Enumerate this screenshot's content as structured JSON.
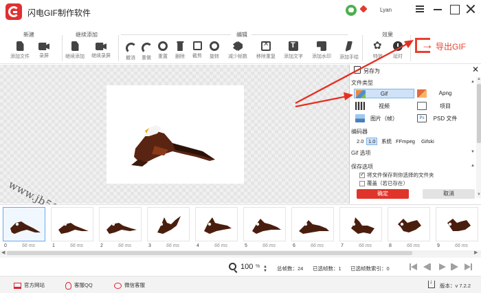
{
  "app": {
    "title": "闪电GIF制作软件",
    "user": "Lyan"
  },
  "toolbar": {
    "groups": {
      "new": "新建",
      "continue_add": "继续添加",
      "edit": "编辑",
      "effects": "效果"
    },
    "buttons": {
      "add_file": "添加文件",
      "record": "录屏",
      "cont_add": "继续添加",
      "cont_record": "继续录屏",
      "undo": "撤消",
      "redo": "重做",
      "reset": "重置",
      "delete": "删除",
      "crop": "截剪",
      "rotate": "旋转",
      "reduce_frames": "减少帧数",
      "remove_dup": "移除重复",
      "add_text": "添加文字",
      "add_watermark": "添加水印",
      "add_handwrite": "添加手绘",
      "effect": "特效",
      "frame_delay": "延时"
    },
    "export_label": "导出GIF",
    "accent": "#e8402e"
  },
  "canvas": {
    "watermark": "www.jb51.net"
  },
  "save_panel": {
    "title": "另存为",
    "file_type_label": "文件类型",
    "file_types": [
      {
        "label": "Gif",
        "selected": true
      },
      {
        "label": "Apng",
        "selected": false
      },
      {
        "label": "视频",
        "selected": false
      },
      {
        "label": "项目",
        "selected": false
      },
      {
        "label": "图片（帧）",
        "selected": false
      },
      {
        "label": "PSD 文件",
        "selected": false
      }
    ],
    "encoder_label": "编码器",
    "encoders": [
      "2.0",
      "1.0",
      "系统",
      "FFmpeg",
      "Gifski"
    ],
    "encoder_selected": "1.0",
    "gif_options_label": "Gif 选项",
    "save_options_label": "保存选项",
    "save_to_folder": "将文件保存到你选择的文件夹",
    "overwrite": "覆盖（若已存在）",
    "ok": "确定",
    "cancel": "取消"
  },
  "frames": [
    {
      "index": "0",
      "ms": "66 ms"
    },
    {
      "index": "1",
      "ms": "66 ms"
    },
    {
      "index": "2",
      "ms": "66 ms"
    },
    {
      "index": "3",
      "ms": "66 ms"
    },
    {
      "index": "4",
      "ms": "66 ms"
    },
    {
      "index": "5",
      "ms": "66 ms"
    },
    {
      "index": "6",
      "ms": "66 ms"
    },
    {
      "index": "7",
      "ms": "66 ms"
    },
    {
      "index": "8",
      "ms": "66 ms"
    },
    {
      "index": "9",
      "ms": "66 ms"
    }
  ],
  "status": {
    "zoom": "100",
    "zoom_unit": "%",
    "total_frames": "总帧数：24",
    "selected_frames": "已选帧数：1",
    "selected_index": "已选帧数索引：0"
  },
  "footer": {
    "website": "官方网站",
    "qq": "客服QQ",
    "wechat": "微信客服",
    "version": "版本：v 7.2.2"
  }
}
